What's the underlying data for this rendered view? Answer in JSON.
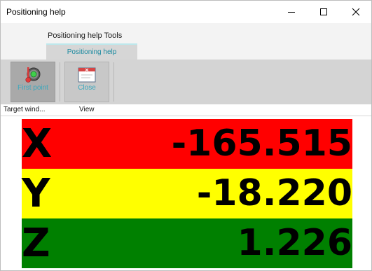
{
  "window": {
    "title": "Positioning help",
    "controls": [
      "minimize",
      "maximize",
      "close"
    ]
  },
  "ribbon": {
    "context_group": "Positioning help Tools",
    "active_tab": "Positioning help",
    "buttons": [
      {
        "label": "First point",
        "icon": "target-icon"
      },
      {
        "label": "Close",
        "icon": "close-window-icon"
      }
    ],
    "groups": [
      {
        "label": "Target wind..."
      },
      {
        "label": "View"
      }
    ]
  },
  "axes": [
    {
      "letter": "X",
      "value": "-165.515",
      "color": "#ff0000"
    },
    {
      "letter": "Y",
      "value": "-18.220",
      "color": "#ffff00"
    },
    {
      "letter": "Z",
      "value": "1.226",
      "color": "#008000"
    }
  ]
}
